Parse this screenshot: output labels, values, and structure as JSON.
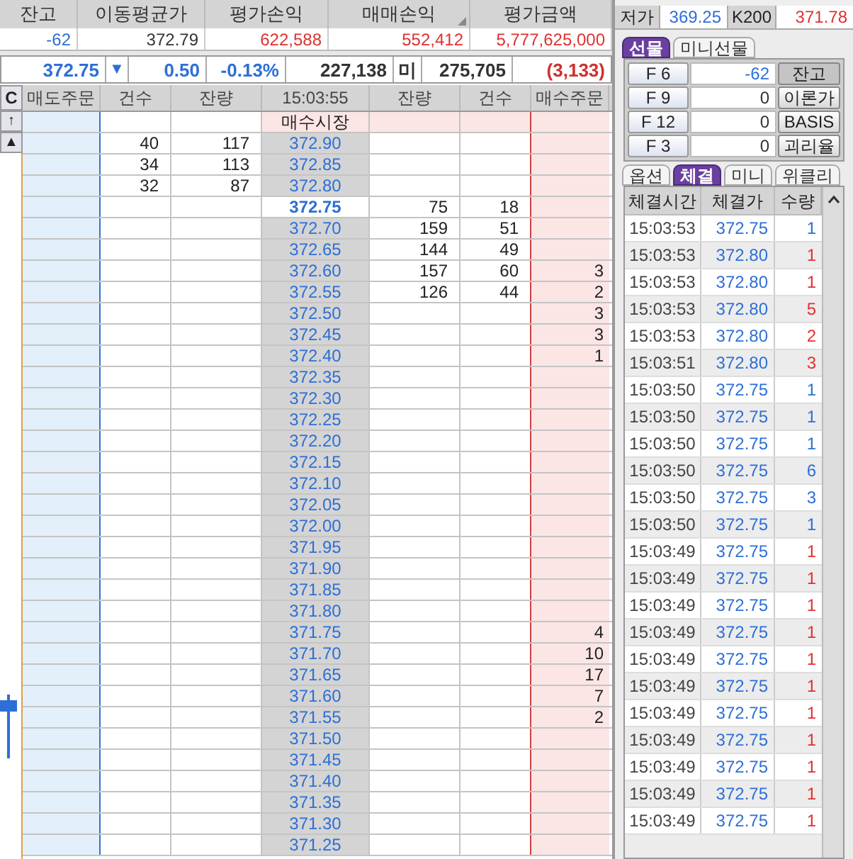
{
  "position": {
    "columns": [
      "잔고",
      "이동평균가",
      "평가손익",
      "매매손익",
      "평가금액"
    ],
    "values": [
      {
        "text": "-62",
        "kind": "down"
      },
      {
        "text": "372.79",
        "kind": "plain"
      },
      {
        "text": "622,588",
        "kind": "up"
      },
      {
        "text": "552,412",
        "kind": "up"
      },
      {
        "text": "5,777,625,000",
        "kind": "up"
      }
    ]
  },
  "quote": {
    "price": "372.75",
    "arrow": "▼",
    "change": "0.50",
    "rate": "-0.13%",
    "volume": "227,138",
    "open_interest_label": "미",
    "open_interest": "275,705",
    "oi_change": "(3,133)"
  },
  "order_book": {
    "corner_button": "C",
    "columns": [
      "매도주문",
      "건수",
      "잔량",
      "15:03:55",
      "잔량",
      "건수",
      "매수주문"
    ],
    "side_buttons": [
      "↑",
      "▲"
    ],
    "rows": [
      {
        "kind": "market",
        "price": "매수시장"
      },
      {
        "kind": "ask",
        "price": "372.90",
        "sell_count": "40",
        "sell_qty": "117"
      },
      {
        "kind": "ask",
        "price": "372.85",
        "sell_count": "34",
        "sell_qty": "113"
      },
      {
        "kind": "ask",
        "price": "372.80",
        "sell_count": "32",
        "sell_qty": "87"
      },
      {
        "kind": "current",
        "price": "372.75",
        "buy_qty": "75",
        "buy_count": "18"
      },
      {
        "kind": "bid",
        "price": "372.70",
        "buy_qty": "159",
        "buy_count": "51"
      },
      {
        "kind": "bid",
        "price": "372.65",
        "buy_qty": "144",
        "buy_count": "49"
      },
      {
        "kind": "bid",
        "price": "372.60",
        "buy_qty": "157",
        "buy_count": "60",
        "buy_order": "3"
      },
      {
        "kind": "bid",
        "price": "372.55",
        "buy_qty": "126",
        "buy_count": "44",
        "buy_order": "2"
      },
      {
        "kind": "bid",
        "price": "372.50",
        "buy_order": "3"
      },
      {
        "kind": "bid",
        "price": "372.45",
        "buy_order": "3"
      },
      {
        "kind": "bid",
        "price": "372.40",
        "buy_order": "1"
      },
      {
        "kind": "bid",
        "price": "372.35"
      },
      {
        "kind": "bid",
        "price": "372.30"
      },
      {
        "kind": "bid",
        "price": "372.25"
      },
      {
        "kind": "bid",
        "price": "372.20"
      },
      {
        "kind": "bid",
        "price": "372.15"
      },
      {
        "kind": "bid",
        "price": "372.10"
      },
      {
        "kind": "bid",
        "price": "372.05"
      },
      {
        "kind": "bid",
        "price": "372.00"
      },
      {
        "kind": "bid",
        "price": "371.95"
      },
      {
        "kind": "bid",
        "price": "371.90"
      },
      {
        "kind": "bid",
        "price": "371.85"
      },
      {
        "kind": "bid",
        "price": "371.80"
      },
      {
        "kind": "bid",
        "price": "371.75",
        "buy_order": "4"
      },
      {
        "kind": "bid",
        "price": "371.70",
        "buy_order": "10"
      },
      {
        "kind": "bid",
        "price": "371.65",
        "buy_order": "17"
      },
      {
        "kind": "bid",
        "price": "371.60",
        "buy_order": "7"
      },
      {
        "kind": "bid",
        "price": "371.55",
        "buy_order": "2"
      },
      {
        "kind": "bid",
        "price": "371.50"
      },
      {
        "kind": "bid",
        "price": "371.45"
      },
      {
        "kind": "bid",
        "price": "371.40"
      },
      {
        "kind": "bid",
        "price": "371.35"
      },
      {
        "kind": "bid",
        "price": "371.30"
      },
      {
        "kind": "bid",
        "price": "371.25"
      }
    ]
  },
  "low_row": {
    "label": "저가",
    "value": "369.25",
    "index_label": "K200",
    "index_value": "371.78"
  },
  "futures_tabs": [
    {
      "label": "선물",
      "selected": true
    },
    {
      "label": "미니선물",
      "selected": false
    }
  ],
  "contracts": [
    {
      "code": "F 6",
      "value": "-62",
      "action": "잔고",
      "selected": true
    },
    {
      "code": "F 9",
      "value": "0",
      "action": "이론가",
      "selected": false
    },
    {
      "code": "F 12",
      "value": "0",
      "action": "BASIS",
      "selected": false
    },
    {
      "code": "F 3",
      "value": "0",
      "action": "괴리율",
      "selected": false
    }
  ],
  "trade_tabs": [
    {
      "label": "옵션",
      "selected": false
    },
    {
      "label": "체결",
      "selected": true
    },
    {
      "label": "미니",
      "selected": false
    },
    {
      "label": "위클리",
      "selected": false
    }
  ],
  "trades": {
    "columns": [
      "체결시간",
      "체결가",
      "수량"
    ],
    "rows": [
      {
        "time": "15:03:53",
        "price": "372.75",
        "qty": "1",
        "kind": "sell"
      },
      {
        "time": "15:03:53",
        "price": "372.80",
        "qty": "1",
        "kind": "buy"
      },
      {
        "time": "15:03:53",
        "price": "372.80",
        "qty": "1",
        "kind": "buy"
      },
      {
        "time": "15:03:53",
        "price": "372.80",
        "qty": "5",
        "kind": "buy"
      },
      {
        "time": "15:03:53",
        "price": "372.80",
        "qty": "2",
        "kind": "buy"
      },
      {
        "time": "15:03:51",
        "price": "372.80",
        "qty": "3",
        "kind": "buy"
      },
      {
        "time": "15:03:50",
        "price": "372.75",
        "qty": "1",
        "kind": "sell"
      },
      {
        "time": "15:03:50",
        "price": "372.75",
        "qty": "1",
        "kind": "sell"
      },
      {
        "time": "15:03:50",
        "price": "372.75",
        "qty": "1",
        "kind": "sell"
      },
      {
        "time": "15:03:50",
        "price": "372.75",
        "qty": "6",
        "kind": "sell"
      },
      {
        "time": "15:03:50",
        "price": "372.75",
        "qty": "3",
        "kind": "sell"
      },
      {
        "time": "15:03:50",
        "price": "372.75",
        "qty": "1",
        "kind": "sell"
      },
      {
        "time": "15:03:49",
        "price": "372.75",
        "qty": "1",
        "kind": "buy"
      },
      {
        "time": "15:03:49",
        "price": "372.75",
        "qty": "1",
        "kind": "buy"
      },
      {
        "time": "15:03:49",
        "price": "372.75",
        "qty": "1",
        "kind": "buy"
      },
      {
        "time": "15:03:49",
        "price": "372.75",
        "qty": "1",
        "kind": "buy"
      },
      {
        "time": "15:03:49",
        "price": "372.75",
        "qty": "1",
        "kind": "buy"
      },
      {
        "time": "15:03:49",
        "price": "372.75",
        "qty": "1",
        "kind": "buy"
      },
      {
        "time": "15:03:49",
        "price": "372.75",
        "qty": "1",
        "kind": "buy"
      },
      {
        "time": "15:03:49",
        "price": "372.75",
        "qty": "1",
        "kind": "buy"
      },
      {
        "time": "15:03:49",
        "price": "372.75",
        "qty": "1",
        "kind": "buy"
      },
      {
        "time": "15:03:49",
        "price": "372.75",
        "qty": "1",
        "kind": "buy"
      },
      {
        "time": "15:03:49",
        "price": "372.75",
        "qty": "1",
        "kind": "buy"
      }
    ]
  }
}
